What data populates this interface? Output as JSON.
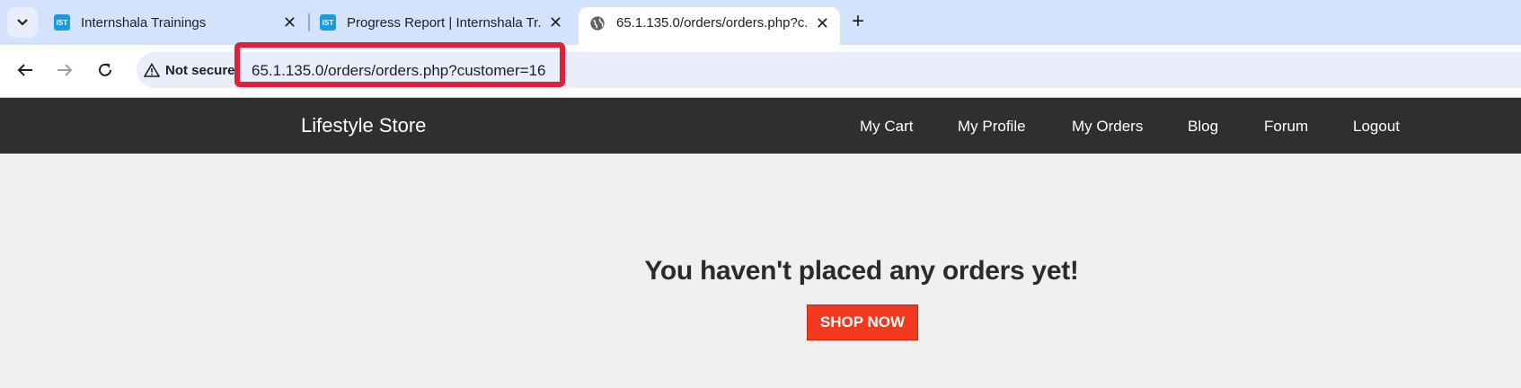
{
  "browser": {
    "tabs": [
      {
        "favicon": "IST",
        "title": "Internshala Trainings"
      },
      {
        "favicon": "IST",
        "title": "Progress Report | Internshala Tr..."
      },
      {
        "favicon": "globe-icon",
        "title": "65.1.135.0/orders/orders.php?c..."
      }
    ],
    "security_label": "Not secure",
    "url": "65.1.135.0/orders/orders.php?customer=16",
    "highlight_color": "#e0203a"
  },
  "site": {
    "brand": "Lifestyle Store",
    "nav": [
      "My Cart",
      "My Profile",
      "My Orders",
      "Blog",
      "Forum",
      "Logout"
    ]
  },
  "main": {
    "message": "You haven't placed any orders yet!",
    "shop_button": "SHOP NOW",
    "button_color": "#f0391f"
  }
}
